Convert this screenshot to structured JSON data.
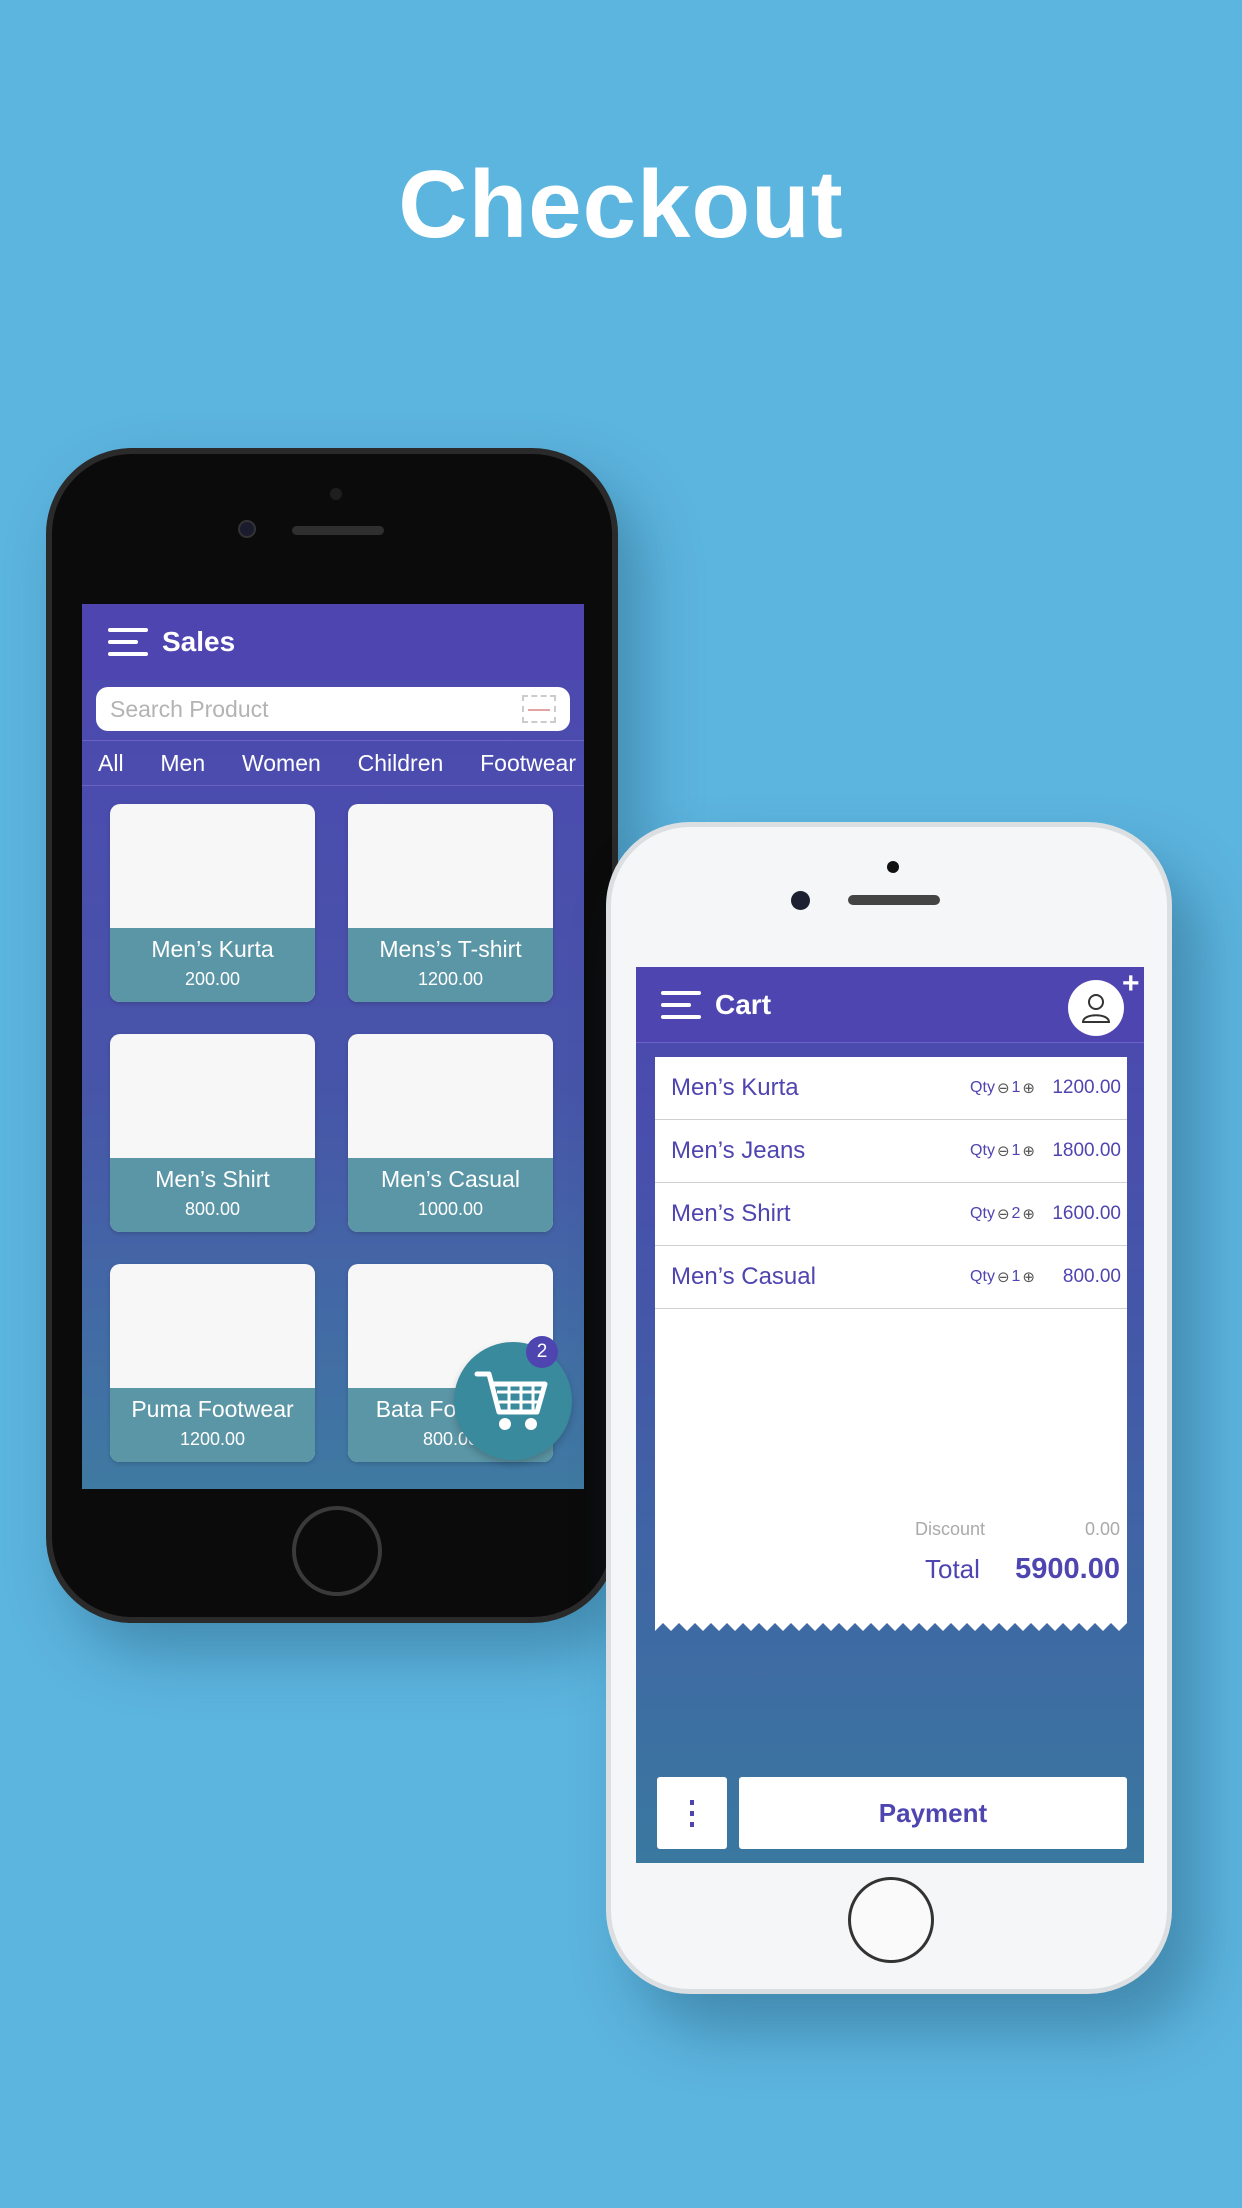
{
  "headline": "Checkout",
  "colors": {
    "background": "#5cb5df",
    "accent": "#4f45b0",
    "card_footer": "#5b96a6"
  },
  "sales": {
    "title": "Sales",
    "menu_icon": "hamburger-icon",
    "search_placeholder": "Search Product",
    "scan_icon": "barcode-icon",
    "categories": [
      "All",
      "Men",
      "Women",
      "Children",
      "Footwear"
    ],
    "products": [
      {
        "name": "Men’s Kurta",
        "price": "200.00"
      },
      {
        "name": "Mens’s T-shirt",
        "price": "1200.00"
      },
      {
        "name": "Men’s Shirt",
        "price": "800.00"
      },
      {
        "name": "Men’s Casual",
        "price": "1000.00"
      },
      {
        "name": "Puma Footwear",
        "price": "1200.00"
      },
      {
        "name": "Bata Footwear",
        "price": "800.00"
      }
    ],
    "cart_icon": "shopping-cart-icon",
    "cart_count": "2"
  },
  "cart": {
    "title": "Cart",
    "menu_icon": "hamburger-icon",
    "add_customer_icon": "add-user-icon",
    "qty_label": "Qty",
    "items": [
      {
        "name": "Men’s Kurta",
        "qty": "1",
        "amount": "1200.00"
      },
      {
        "name": "Men’s Jeans",
        "qty": "1",
        "amount": "1800.00"
      },
      {
        "name": "Men’s Shirt",
        "qty": "2",
        "amount": "1600.00"
      },
      {
        "name": "Men’s Casual",
        "qty": "1",
        "amount": "800.00"
      }
    ],
    "discount_label": "Discount",
    "discount_value": "0.00",
    "total_label": "Total",
    "total_value": "5900.00",
    "more_icon": "more-vertical-icon",
    "payment_label": "Payment"
  }
}
